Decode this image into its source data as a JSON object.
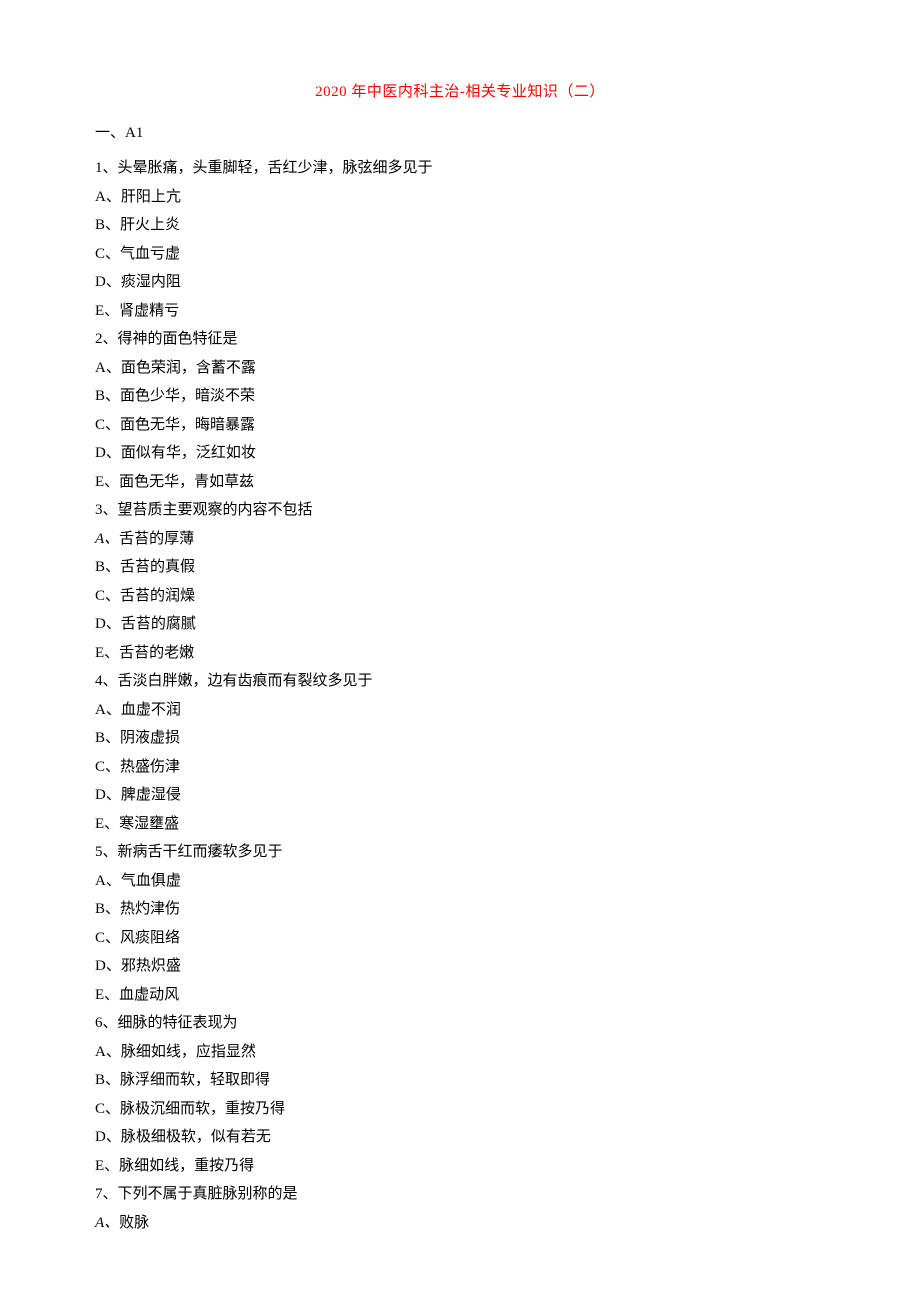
{
  "title": "2020 年中医内科主治-相关专业知识（二）",
  "section": "一、A1",
  "questions": [
    {
      "num": "1、",
      "stem": "头晕胀痛，头重脚轻，舌红少津，脉弦细多见于",
      "opts": [
        {
          "letter": "A、",
          "text": "肝阳上亢"
        },
        {
          "letter": "B、",
          "text": "肝火上炎"
        },
        {
          "letter": "C、",
          "text": "气血亏虚"
        },
        {
          "letter": "D、",
          "text": "痰湿内阻"
        },
        {
          "letter": "E、",
          "text": "肾虚精亏"
        }
      ]
    },
    {
      "num": "2、",
      "stem": "得神的面色特征是",
      "opts": [
        {
          "letter": "A、",
          "text": "面色荣润，含蓄不露"
        },
        {
          "letter": "B、",
          "text": "面色少华，暗淡不荣"
        },
        {
          "letter": "C、",
          "text": "面色无华，晦暗暴露"
        },
        {
          "letter": "D、",
          "text": "面似有华，泛红如妆"
        },
        {
          "letter": "E、",
          "text": "面色无华，青如草兹"
        }
      ]
    },
    {
      "num": "3、",
      "stem": "望苔质主要观察的内容不包括",
      "opts": [
        {
          "letter": "A、",
          "text": "舌苔的厚薄",
          "italic": true
        },
        {
          "letter": "B、",
          "text": "舌苔的真假"
        },
        {
          "letter": "C、",
          "text": "舌苔的润燥"
        },
        {
          "letter": "D、",
          "text": "舌苔的腐腻"
        },
        {
          "letter": "E、",
          "text": "舌苔的老嫩"
        }
      ]
    },
    {
      "num": "4、",
      "stem": "舌淡白胖嫩，边有齿痕而有裂纹多见于",
      "opts": [
        {
          "letter": "A、",
          "text": "血虚不润"
        },
        {
          "letter": "B、",
          "text": "阴液虚损"
        },
        {
          "letter": "C、",
          "text": "热盛伤津"
        },
        {
          "letter": "D、",
          "text": "脾虚湿侵"
        },
        {
          "letter": "E、",
          "text": "寒湿壅盛"
        }
      ]
    },
    {
      "num": "5、",
      "stem": "新病舌干红而痿软多见于",
      "opts": [
        {
          "letter": "A、",
          "text": "气血俱虚"
        },
        {
          "letter": "B、",
          "text": "热灼津伤"
        },
        {
          "letter": "C、",
          "text": "风痰阻络"
        },
        {
          "letter": "D、",
          "text": "邪热炽盛"
        },
        {
          "letter": "E、",
          "text": "血虚动风"
        }
      ]
    },
    {
      "num": "6、",
      "stem": "细脉的特征表现为",
      "opts": [
        {
          "letter": "A、",
          "text": "脉细如线，应指显然"
        },
        {
          "letter": "B、",
          "text": "脉浮细而软，轻取即得"
        },
        {
          "letter": "C、",
          "text": "脉极沉细而软，重按乃得"
        },
        {
          "letter": "D、",
          "text": "脉极细极软，似有若无"
        },
        {
          "letter": "E、",
          "text": "脉细如线，重按乃得"
        }
      ]
    },
    {
      "num": "7、",
      "stem": "下列不属于真脏脉别称的是",
      "opts": [
        {
          "letter": "A、",
          "text": "败脉",
          "italic": true
        }
      ]
    }
  ]
}
